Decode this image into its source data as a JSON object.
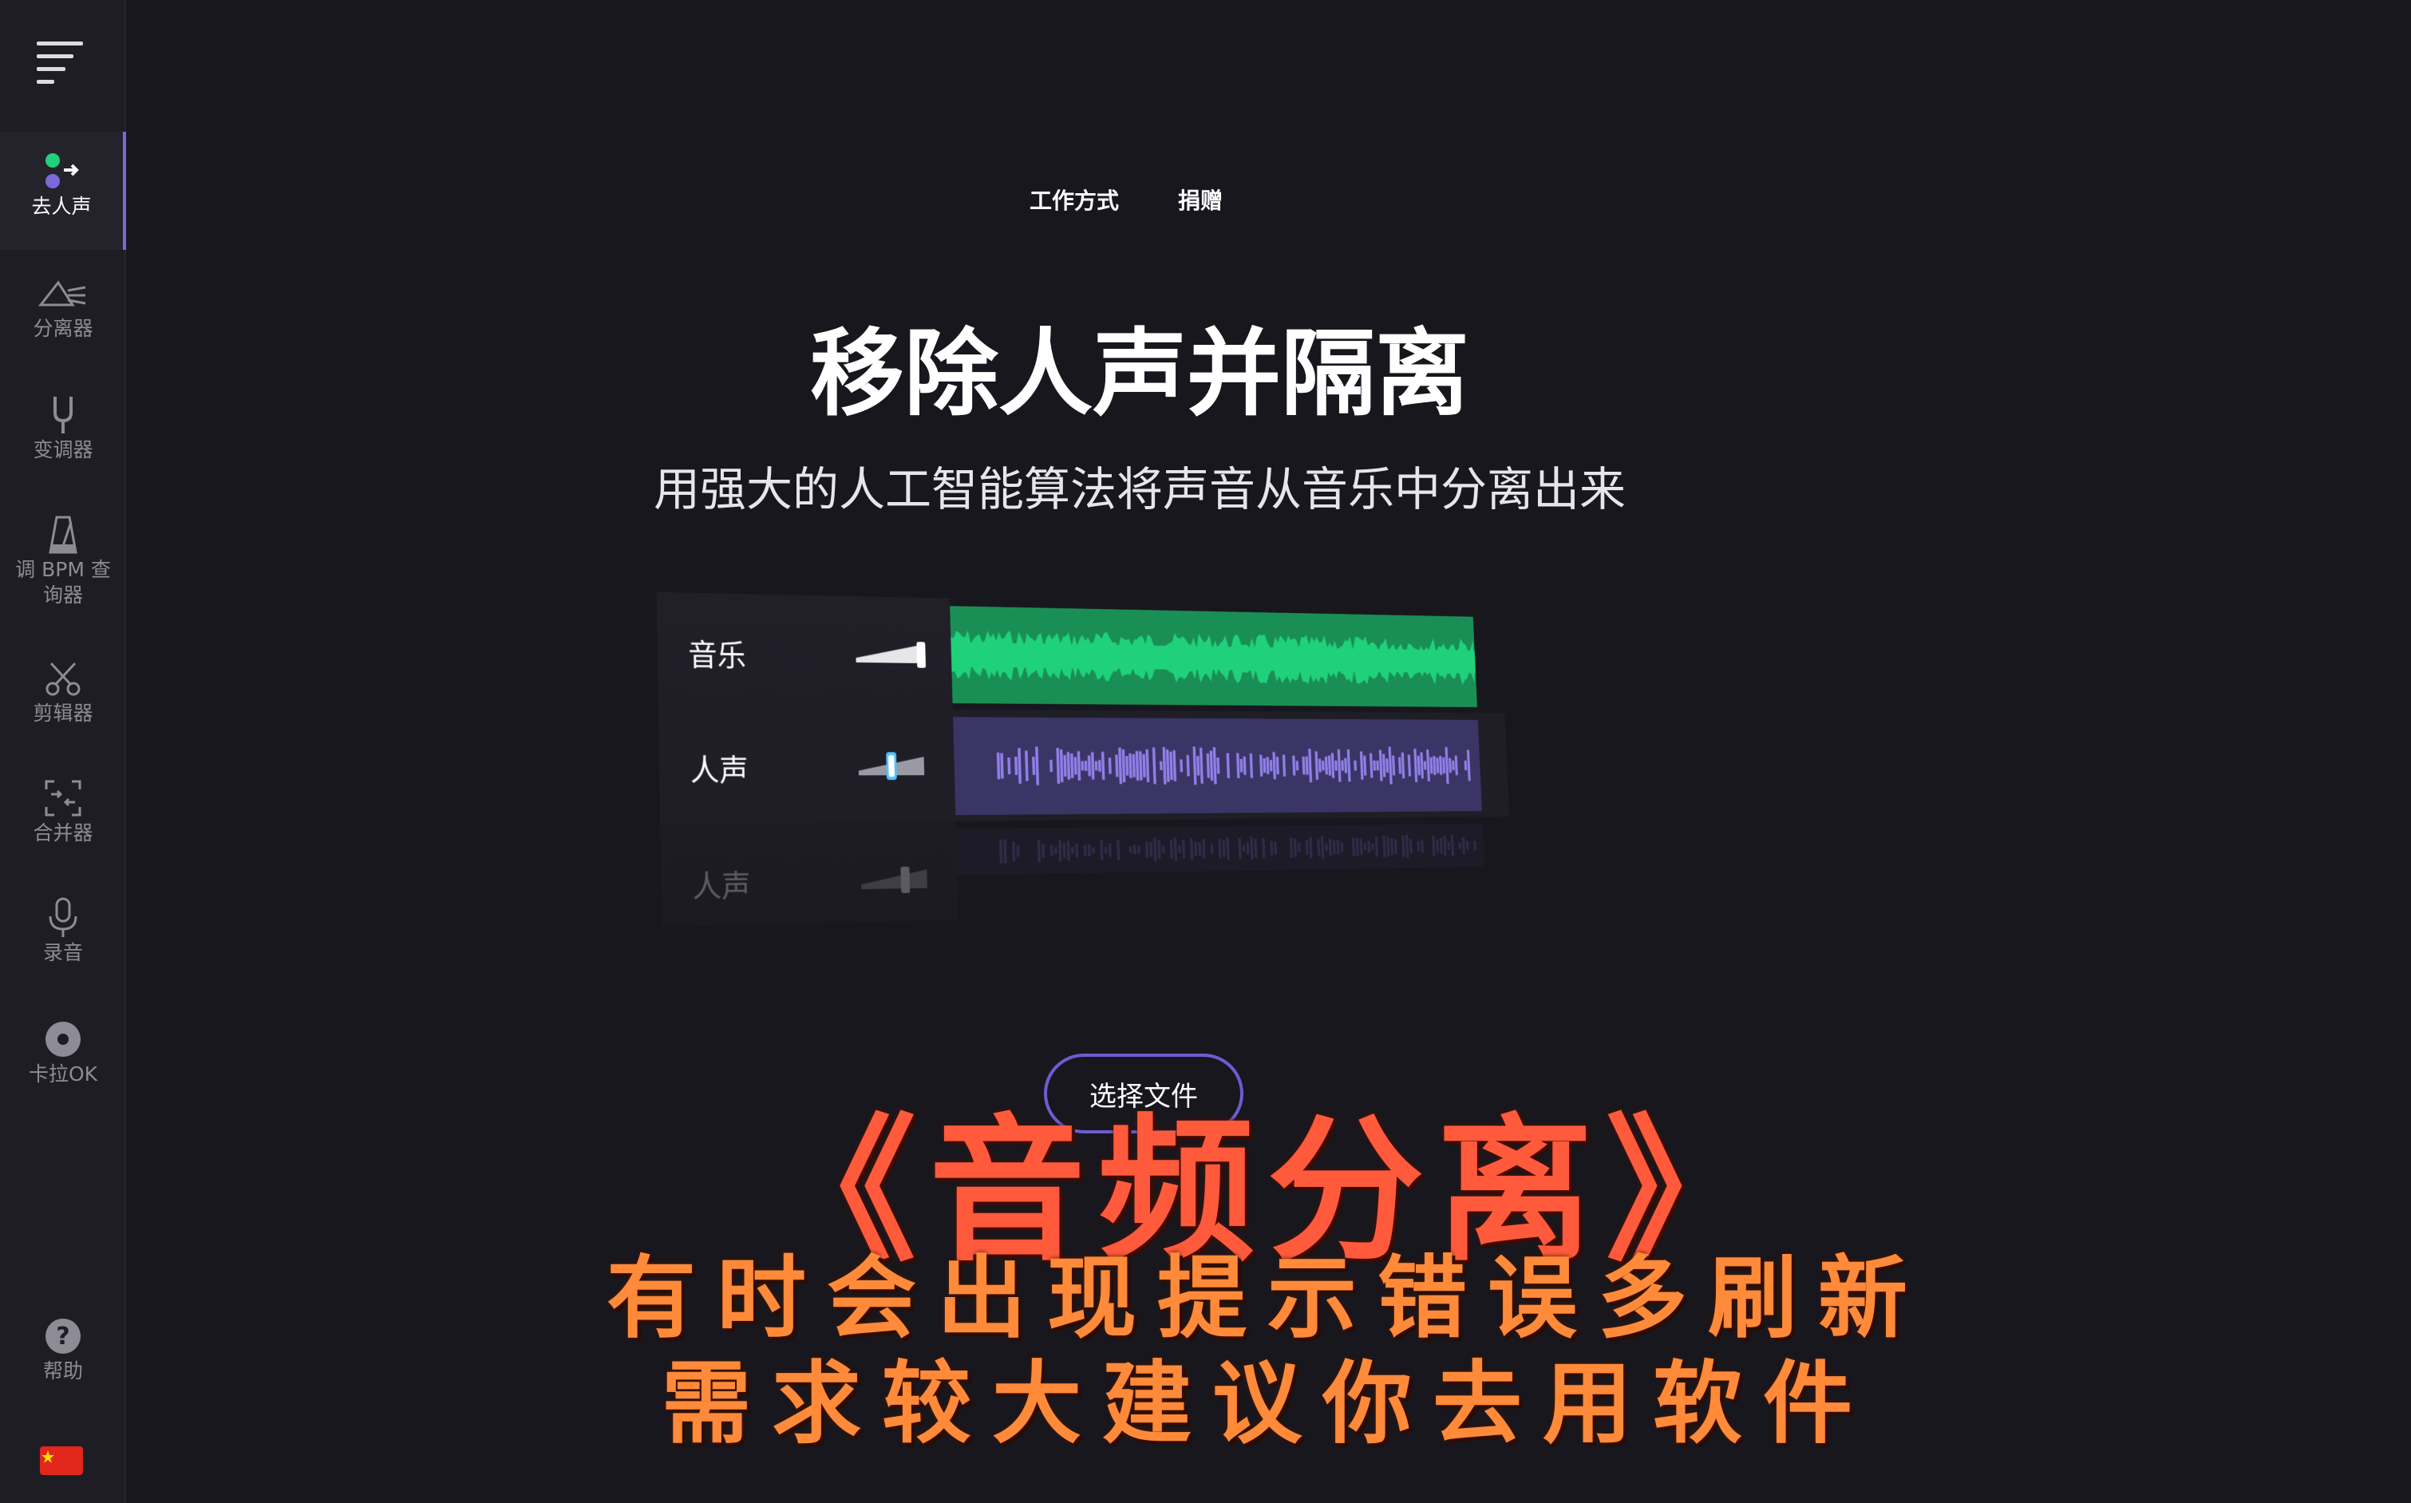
{
  "sidebar": {
    "items": [
      {
        "label": "去人声",
        "icon": "vocal-remover-icon",
        "active": true
      },
      {
        "label": "分离器",
        "icon": "splitter-icon",
        "active": false
      },
      {
        "label": "变调器",
        "icon": "tuning-fork-icon",
        "active": false
      },
      {
        "label": "调 BPM 查\n询器",
        "icon": "metronome-icon",
        "active": false
      },
      {
        "label": "剪辑器",
        "icon": "scissors-icon",
        "active": false
      },
      {
        "label": "合并器",
        "icon": "merge-icon",
        "active": false
      },
      {
        "label": "录音",
        "icon": "microphone-icon",
        "active": false
      },
      {
        "label": "卡拉OK",
        "icon": "disc-icon",
        "active": false
      }
    ],
    "help_label": "帮助"
  },
  "header": {
    "links": [
      "工作方式",
      "捐赠"
    ]
  },
  "hero": {
    "title": "移除人声并隔离",
    "subtitle": "用强大的人工智能算法将声音从音乐中分离出来"
  },
  "preview": {
    "tracks": [
      {
        "name": "音乐",
        "color": "#1fd17a"
      },
      {
        "name": "人声",
        "color": "#8f7fe6"
      },
      {
        "name": "人声",
        "color": "#6a5fb0"
      }
    ]
  },
  "select_button_label": "选择文件",
  "overlay": {
    "title": "《音频分离》",
    "line1": "有时会出现提示错误多刷新",
    "line2": "需求较大建议你去用软件"
  },
  "colors": {
    "background": "#18171d",
    "sidebar": "#1e1d24",
    "accent": "#7a6ad8",
    "music_wave": "#1fd17a",
    "vocal_wave": "#8f7fe6",
    "overlay_title": "#ff5a3c",
    "overlay_text": "#ff8a3a"
  }
}
